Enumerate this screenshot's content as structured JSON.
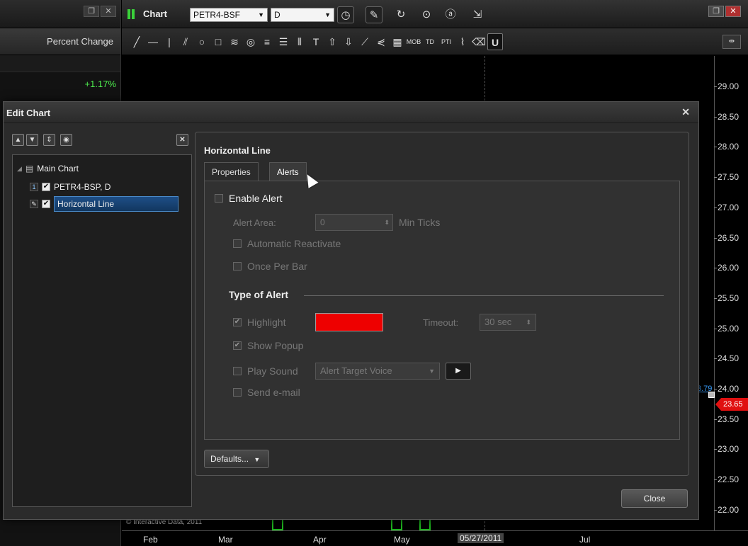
{
  "left_panel": {
    "header": "Percent Change",
    "value": "+1.17%"
  },
  "chart_window": {
    "title": "Chart",
    "symbol": "PETR4-BSF",
    "period": "D",
    "copyright": "© Interactive Data, 2011",
    "y_ticks": [
      "29.00",
      "28.50",
      "28.00",
      "27.50",
      "27.00",
      "26.50",
      "26.00",
      "25.50",
      "25.00",
      "24.50",
      "24.00",
      "23.50",
      "23.00",
      "22.50",
      "22.00"
    ],
    "price_badge": "23.65",
    "hline_label": "3.79",
    "x_ticks": [
      "Feb",
      "Mar",
      "Apr",
      "May",
      "05/27/2011",
      "Jul"
    ]
  },
  "dialog": {
    "title": "Edit Chart",
    "tree": {
      "main": "Main Chart",
      "series": "PETR4-BSP, D",
      "series_badge": "1",
      "selected": "Horizontal Line"
    },
    "panel_title": "Horizontal Line",
    "tabs": [
      "Properties",
      "Alerts"
    ],
    "alerts": {
      "enable_label": "Enable Alert",
      "alert_area_label": "Alert Area:",
      "alert_area_value": "0",
      "min_ticks": "Min Ticks",
      "auto_reactivate": "Automatic Reactivate",
      "once_per_bar": "Once Per Bar",
      "type_heading": "Type of Alert",
      "highlight": "Highlight",
      "highlight_color": "#ee0000",
      "timeout_label": "Timeout:",
      "timeout_value": "30 sec",
      "show_popup": "Show Popup",
      "play_sound": "Play Sound",
      "sound_value": "Alert Target Voice",
      "send_email": "Send e-mail"
    },
    "defaults_button": "Defaults...",
    "close_button": "Close"
  }
}
